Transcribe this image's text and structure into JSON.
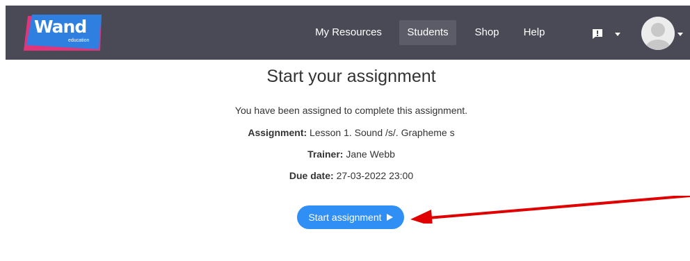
{
  "brand": {
    "name": "Wand",
    "sub": "education",
    "colors": {
      "blue": "#2f7fe0",
      "pink": "#e0357a"
    }
  },
  "nav": {
    "items": [
      {
        "label": "My Resources",
        "active": false
      },
      {
        "label": "Students",
        "active": true
      },
      {
        "label": "Shop",
        "active": false
      },
      {
        "label": "Help",
        "active": false
      }
    ],
    "alert_icon": "alert-icon",
    "avatar_icon": "avatar-icon",
    "bar_color": "#4a4a57"
  },
  "assignment": {
    "title": "Start your assignment",
    "intro": "You have been assigned to complete this assignment.",
    "assignment_label": "Assignment:",
    "assignment_value": "Lesson 1. Sound /s/. Grapheme s",
    "trainer_label": "Trainer:",
    "trainer_value": "Jane Webb",
    "due_label": "Due date:",
    "due_value": "27-03-2022 23:00",
    "start_button": "Start assignment",
    "button_color": "#2f8ff5"
  },
  "annotation": {
    "arrow_color": "#e00000"
  }
}
